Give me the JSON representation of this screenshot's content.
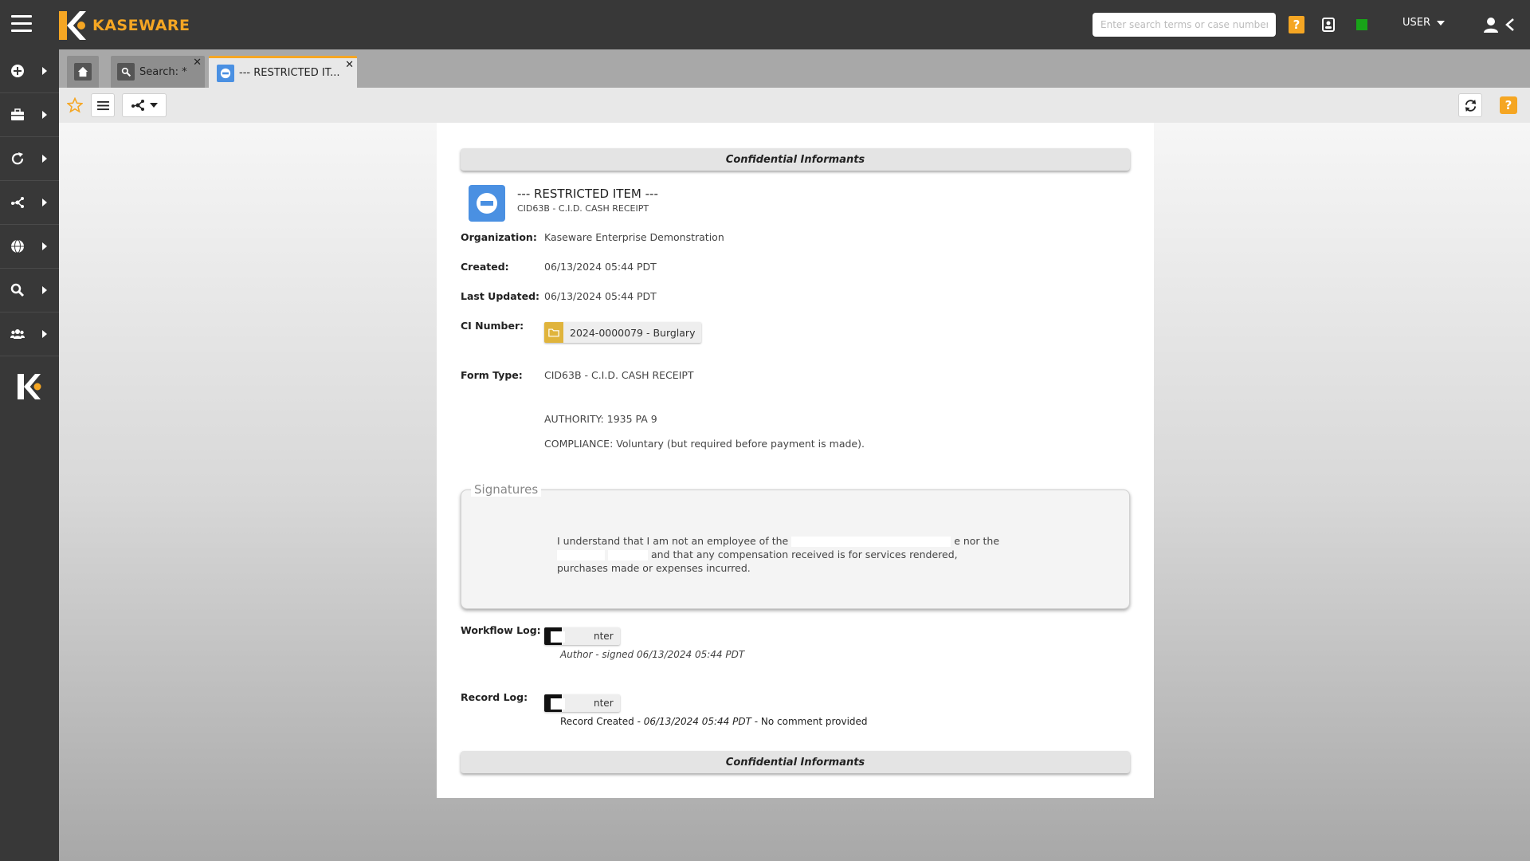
{
  "app": {
    "brand": "KASEWARE",
    "search_placeholder": "Enter search terms or case number",
    "help_label": "?",
    "user_label": "USER",
    "brand_color": "#f5a623",
    "status_color": "#18a418"
  },
  "sidebar": {
    "items": [
      {
        "icon": "plus-circle-icon"
      },
      {
        "icon": "briefcase-icon"
      },
      {
        "icon": "refresh-icon"
      },
      {
        "icon": "network-icon"
      },
      {
        "icon": "globe-icon"
      },
      {
        "icon": "search-icon"
      },
      {
        "icon": "users-icon"
      }
    ]
  },
  "tabs": [
    {
      "label": "",
      "icon": "home-icon"
    },
    {
      "label": "Search: *",
      "icon": "search-icon"
    },
    {
      "label": "--- RESTRICTED IT...",
      "icon": "restricted-icon",
      "active": true
    }
  ],
  "toolbar": {
    "help_label": "?"
  },
  "record": {
    "section_title": "Confidential Informants",
    "title": "--- RESTRICTED ITEM ---",
    "subtitle": "CID63B - C.I.D. CASH RECEIPT",
    "fields": {
      "organization_label": "Organization:",
      "organization_value": "Kaseware Enterprise Demonstration",
      "created_label": "Created:",
      "created_value": "06/13/2024 05:44 PDT",
      "updated_label": "Last Updated:",
      "updated_value": "06/13/2024 05:44 PDT",
      "ci_label": "CI Number:",
      "ci_value": "2024-0000079 - Burglary",
      "form_type_label": "Form Type:",
      "form_type_value": "CID63B - C.I.D. CASH RECEIPT",
      "authority": "AUTHORITY: 1935 PA 9",
      "compliance": "COMPLIANCE: Voluntary (but required before payment is made)."
    },
    "signatures": {
      "legend": "Signatures",
      "text_part1": "I understand that I am not an employee of the",
      "text_part2": "e nor the",
      "text_part3": "and that any compensation received is for services rendered, purchases made or expenses incurred."
    },
    "workflow_log": {
      "label": "Workflow Log:",
      "user_suffix": "nter",
      "entry": "Author - signed 06/13/2024 05:44 PDT"
    },
    "record_log": {
      "label": "Record Log:",
      "user_suffix": "nter",
      "entry_action": "Record Created",
      "entry_time": "06/13/2024 05:44 PDT",
      "entry_comment": "No comment provided"
    }
  }
}
